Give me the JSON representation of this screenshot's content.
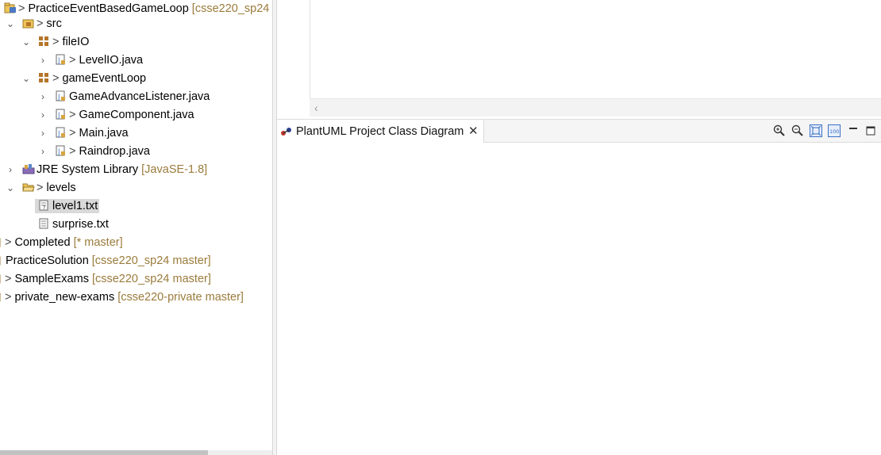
{
  "explorer": {
    "rows": [
      {
        "decoration": ">",
        "label": "PracticeEventBasedGameLoop",
        "qualifier": "[csse220_sp24"
      },
      {
        "chevron": "⌄",
        "decoration": ">",
        "label": "src"
      },
      {
        "chevron": "⌄",
        "decoration": ">",
        "label": "fileIO"
      },
      {
        "chevron": "›",
        "decoration": ">",
        "label": "LevelIO.java"
      },
      {
        "chevron": "⌄",
        "decoration": ">",
        "label": "gameEventLoop"
      },
      {
        "chevron": "›",
        "label": "GameAdvanceListener.java"
      },
      {
        "chevron": "›",
        "decoration": ">",
        "label": "GameComponent.java"
      },
      {
        "chevron": "›",
        "decoration": ">",
        "label": "Main.java"
      },
      {
        "chevron": "›",
        "decoration": ">",
        "label": "Raindrop.java"
      },
      {
        "chevron": "›",
        "label": "JRE System Library",
        "qualifier": "[JavaSE-1.8]"
      },
      {
        "chevron": "⌄",
        "decoration": ">",
        "label": "levels"
      },
      {
        "label": "level1.txt"
      },
      {
        "label": "surprise.txt"
      },
      {
        "decoration": ">",
        "label": "Completed",
        "qualifier": "[* master]"
      },
      {
        "label": "PracticeSolution",
        "qualifier": "[csse220_sp24 master]"
      },
      {
        "decoration": ">",
        "label": "SampleExams",
        "qualifier": "[csse220_sp24 master]"
      },
      {
        "decoration": ">",
        "label": "private_new-exams",
        "qualifier": "[csse220-private master]"
      }
    ],
    "icons": [
      "project-icon",
      "source-folder-icon",
      "package-icon",
      "java-file-icon",
      "library-icon",
      "folder-icon",
      "text-file-icon"
    ]
  },
  "editor": {
    "scroll_left_glyph": "‹"
  },
  "view": {
    "tab_label": "PlantUML Project Class Diagram",
    "tab_close": "✕",
    "toolbar": [
      "zoom-in-icon",
      "zoom-out-icon",
      "zoom-fit-icon",
      "zoom-100-icon",
      "minimize-icon",
      "maximize-icon"
    ],
    "zoom_100_text": "100"
  },
  "colors": {
    "qualifier": "#9b7b3b",
    "selection": "#d9d9d9",
    "package": "#b5752a"
  }
}
